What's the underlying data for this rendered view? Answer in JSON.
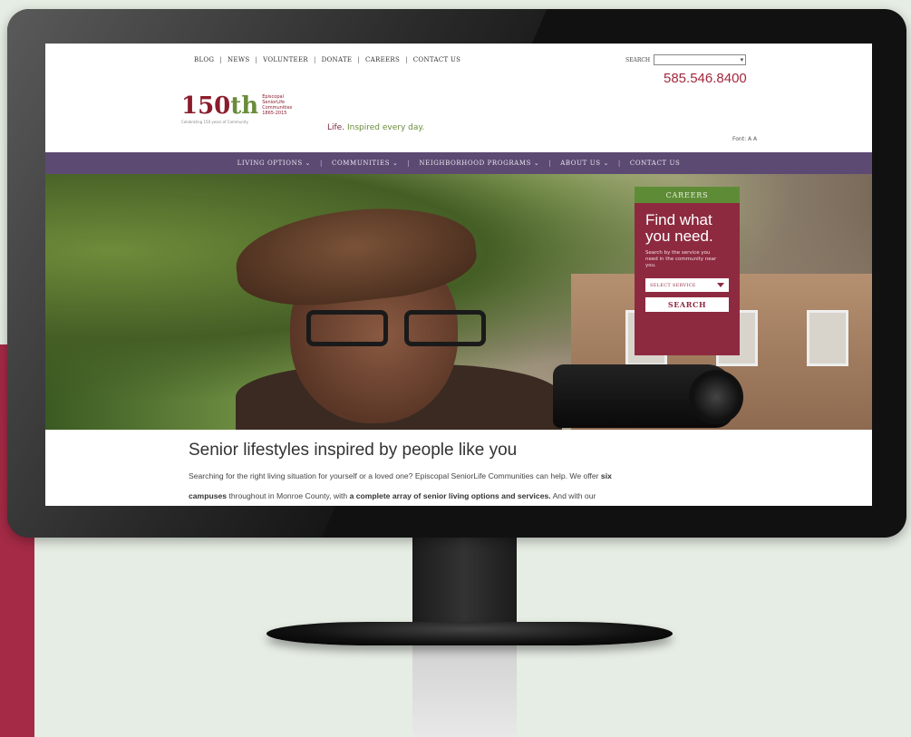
{
  "utility_nav": [
    "BLOG",
    "NEWS",
    "VOLUNTEER",
    "DONATE",
    "CAREERS",
    "CONTACT US"
  ],
  "search": {
    "label": "SEARCH",
    "placeholder": ""
  },
  "phone": "585.546.8400",
  "logo": {
    "number": "150",
    "suffix": "th",
    "org": "Episcopal SeniorLife Communities",
    "years": "1865-2015",
    "tagline": "Celebrating 150 years of Community"
  },
  "life_tagline": {
    "lead": "Life.",
    "rest": "Inspired every day."
  },
  "font_size": "Font: A A",
  "main_nav": [
    "LIVING OPTIONS ⌄",
    "COMMUNITIES ⌄",
    "NEIGHBORHOOD PROGRAMS ⌄",
    "ABOUT US ⌄",
    "CONTACT US"
  ],
  "finder": {
    "careers_tab": "CAREERS",
    "heading": "Find what you need.",
    "text": "Search by the service you need in the community near you.",
    "select_label": "SELECT SERVICE",
    "button": "SEARCH"
  },
  "content": {
    "title": "Senior lifestyles inspired by people like you",
    "p1": "Searching for the right living situation for yourself or a loved one? Episcopal SeniorLife Communities can help. We offer",
    "p1_bold": "six",
    "p2_bold1": "campuses",
    "p2": "throughout in Monroe County, with",
    "p2_bold2": "a complete array of senior living options and services.",
    "p2_end": "And with our"
  },
  "colors": {
    "maroon": "#8e2a40",
    "nav_purple": "#5c4a73",
    "careers_green": "#5e8c36"
  }
}
